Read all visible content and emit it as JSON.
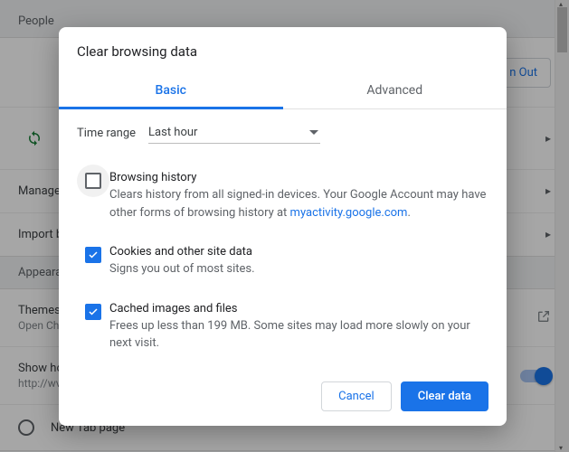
{
  "background": {
    "section_people": "People",
    "sign_out": "n Out",
    "manage_row": "Manage b",
    "import_row": "Import b",
    "section_appearance": "Appearance",
    "themes_label": "Themes",
    "themes_sub": "Open Ch",
    "show_home_label": "Show ho",
    "show_home_sub": "http://wv",
    "new_tab_label": "New Tab page"
  },
  "dialog": {
    "title": "Clear browsing data",
    "tabs": {
      "basic": "Basic",
      "advanced": "Advanced"
    },
    "time_range_label": "Time range",
    "time_range_value": "Last hour",
    "options": [
      {
        "checked": false,
        "hover": true,
        "title": "Browsing history",
        "desc_pre": "Clears history from all signed-in devices. Your Google Account may have other forms of browsing history at ",
        "desc_link": "myactivity.google.com",
        "desc_post": "."
      },
      {
        "checked": true,
        "hover": false,
        "title": "Cookies and other site data",
        "desc_pre": "Signs you out of most sites.",
        "desc_link": "",
        "desc_post": ""
      },
      {
        "checked": true,
        "hover": false,
        "title": "Cached images and files",
        "desc_pre": "Frees up less than 199 MB. Some sites may load more slowly on your next visit.",
        "desc_link": "",
        "desc_post": ""
      }
    ],
    "cancel": "Cancel",
    "confirm": "Clear data"
  }
}
